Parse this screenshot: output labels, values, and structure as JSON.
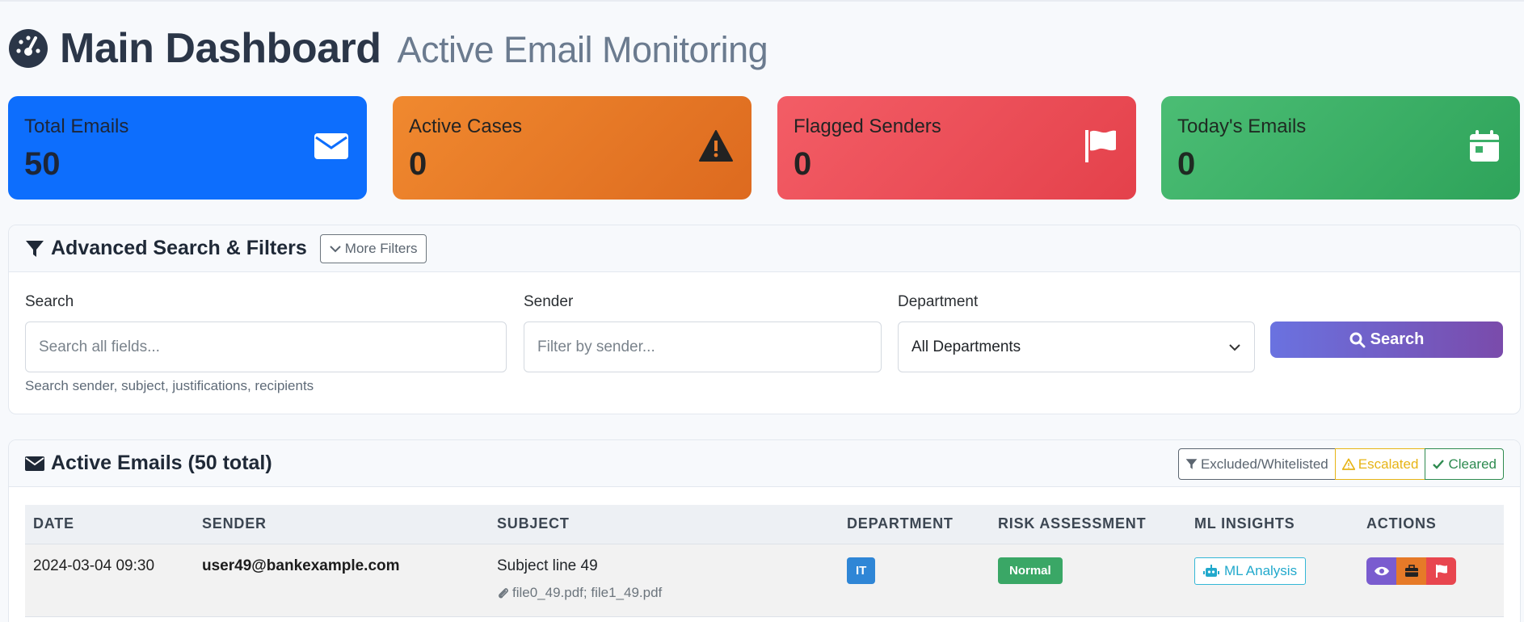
{
  "header": {
    "title": "Main Dashboard",
    "subtitle": "Active Email Monitoring"
  },
  "stats": [
    {
      "label": "Total Emails",
      "value": "50",
      "icon": "envelope-icon",
      "color": "#0d6efd"
    },
    {
      "label": "Active Cases",
      "value": "0",
      "icon": "warning-icon",
      "color": "#e87b2a"
    },
    {
      "label": "Flagged Senders",
      "value": "0",
      "icon": "flag-icon",
      "color": "#ee4e57"
    },
    {
      "label": "Today's Emails",
      "value": "0",
      "icon": "calendar-icon",
      "color": "#3cb069"
    }
  ],
  "filters": {
    "title": "Advanced Search & Filters",
    "more_filters": "More Filters",
    "search_label": "Search",
    "search_placeholder": "Search all fields...",
    "search_help": "Search sender, subject, justifications, recipients",
    "sender_label": "Sender",
    "sender_placeholder": "Filter by sender...",
    "department_label": "Department",
    "department_value": "All Departments",
    "search_button": "Search"
  },
  "emails": {
    "title": "Active Emails (50 total)",
    "buttons": {
      "excluded": "Excluded/Whitelisted",
      "escalated": "Escalated",
      "cleared": "Cleared"
    },
    "columns": [
      "DATE",
      "SENDER",
      "SUBJECT",
      "DEPARTMENT",
      "RISK ASSESSMENT",
      "ML INSIGHTS",
      "ACTIONS"
    ],
    "rows": [
      {
        "date": "2024-03-04 09:30",
        "sender": "user49@bankexample.com",
        "subject": "Subject line 49",
        "attachments": "file0_49.pdf; file1_49.pdf",
        "department": "IT",
        "risk": "Normal",
        "ml": "ML Analysis"
      }
    ]
  }
}
